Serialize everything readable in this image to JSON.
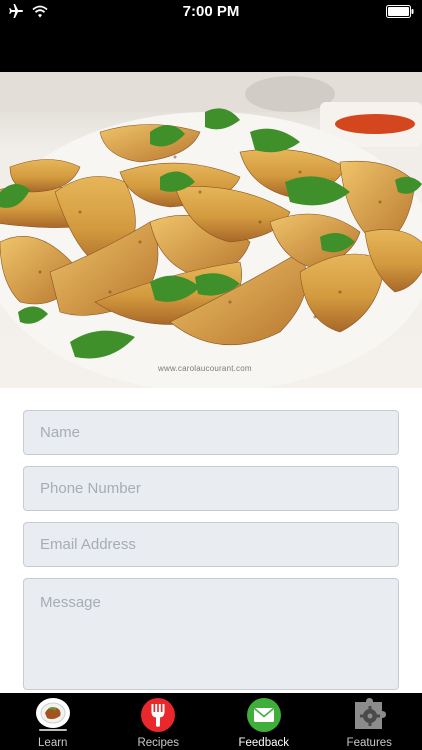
{
  "status_bar": {
    "time": "7:00 PM",
    "icons": [
      "airplane-icon",
      "wifi-icon",
      "battery-icon"
    ]
  },
  "hero": {
    "watermark": "www.carolaucourant.com"
  },
  "form": {
    "name_placeholder": "Name",
    "phone_placeholder": "Phone Number",
    "email_placeholder": "Email Address",
    "message_placeholder": "Message"
  },
  "tab_bar": {
    "active_tab": "Feedback",
    "tabs": [
      {
        "label": "Learn",
        "icon": "plate-icon"
      },
      {
        "label": "Recipes",
        "icon": "fork-icon"
      },
      {
        "label": "Feedback",
        "icon": "envelope-icon"
      },
      {
        "label": "Features",
        "icon": "puzzle-gear-icon"
      }
    ]
  },
  "colors": {
    "bar_background": "#000000",
    "field_background": "#e9ecf1",
    "field_border": "#c7ccd3",
    "recipes_red": "#e8282b",
    "feedback_green": "#3fae3a"
  }
}
